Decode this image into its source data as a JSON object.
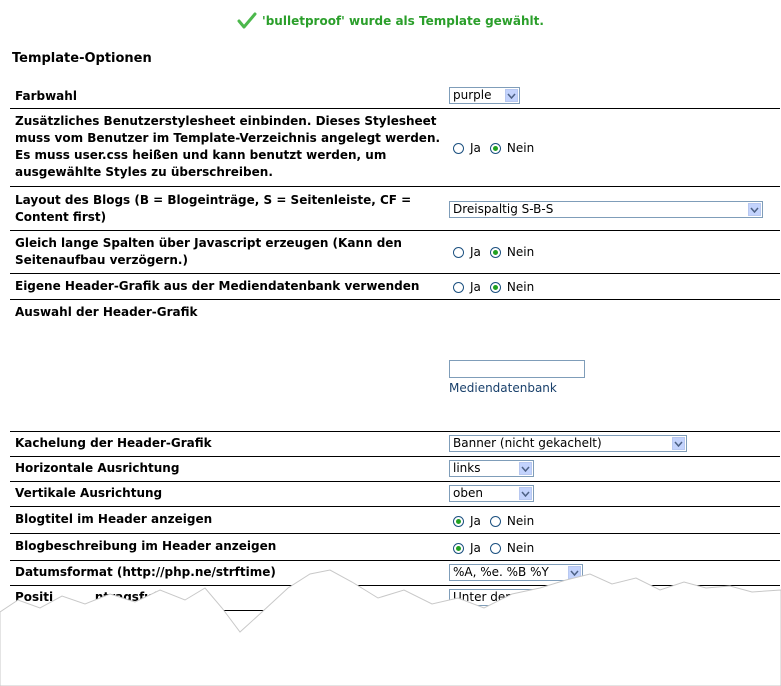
{
  "message": {
    "text": "'bulletproof' wurde als Template gewählt.",
    "icon": "checkmark-icon",
    "color": "#2b9f2b"
  },
  "section_title": "Template-Optionen",
  "radio_yes": "Ja",
  "radio_no": "Nein",
  "options": {
    "farbwahl": {
      "label": "Farbwahl",
      "value": "purple"
    },
    "userstyles": {
      "label": "Zusätzliches Benutzerstylesheet einbinden. Dieses Stylesheet muss vom Benutzer im Template-Verzeichnis angelegt werden. Es muss user.css heißen und kann benutzt werden, um ausgewählte Styles zu überschreiben.",
      "selected": "Nein"
    },
    "layout": {
      "label": "Layout des Blogs (B = Blogeinträge, S = Seitenleiste, CF = Content first)",
      "value": "Dreispaltig S-B-S"
    },
    "spalten": {
      "label": "Gleich lange Spalten über Javascript erzeugen (Kann den Seitenaufbau verzögern.)",
      "selected": "Nein"
    },
    "header_grafik": {
      "label": "Eigene Header-Grafik aus der Mediendatenbank verwenden",
      "selected": "Nein"
    },
    "auswahl": {
      "label": "Auswahl der Header-Grafik",
      "input_value": "",
      "link": "Mediendatenbank"
    },
    "kachelung": {
      "label": "Kachelung der Header-Grafik",
      "value": "Banner (nicht gekachelt)"
    },
    "horizontal": {
      "label": "Horizontale Ausrichtung",
      "value": "links"
    },
    "vertikal": {
      "label": "Vertikale Ausrichtung",
      "value": "oben"
    },
    "blogtitel": {
      "label": "Blogtitel im Header anzeigen",
      "selected": "Ja"
    },
    "blogbeschreibung": {
      "label": "Blogbeschreibung im Header anzeigen",
      "selected": "Ja"
    },
    "datumsformat": {
      "label": "Datumsformat (http://php.ne/strftime)",
      "value": "%A, %e. %B %Y"
    },
    "position": {
      "label": "Positi          ntragsfuß",
      "value": "Unter dem Eintr"
    }
  }
}
